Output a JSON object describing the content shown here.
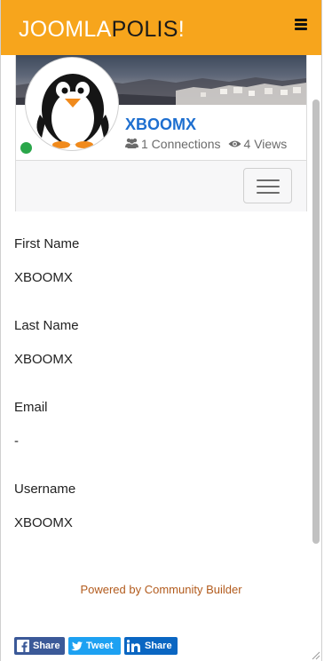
{
  "header": {
    "brand_white": "JOOMLA",
    "brand_black": "POLIS",
    "brand_mark": "!",
    "menu_icon": "bars-icon"
  },
  "profile": {
    "name": "XBOOMX",
    "connections": "1 Connections",
    "views": "4 Views",
    "status": "online",
    "avatar": "penguin-avatar"
  },
  "fields": [
    {
      "label": "First Name",
      "value": "XBOOMX"
    },
    {
      "label": "Last Name",
      "value": "XBOOMX"
    },
    {
      "label": "Email",
      "value": "-"
    },
    {
      "label": "Username",
      "value": "XBOOMX"
    }
  ],
  "footer": {
    "powered": "Powered by Community Builder"
  },
  "share": {
    "facebook": "Share",
    "twitter": "Tweet",
    "linkedin": "Share"
  },
  "colors": {
    "header_bg": "#f7a51c",
    "name_link": "#1e6fd0",
    "online": "#2aa64a",
    "powered_text": "#b25b1d",
    "facebook": "#3b5998",
    "twitter": "#1da1f2",
    "linkedin": "#0a66c2"
  }
}
